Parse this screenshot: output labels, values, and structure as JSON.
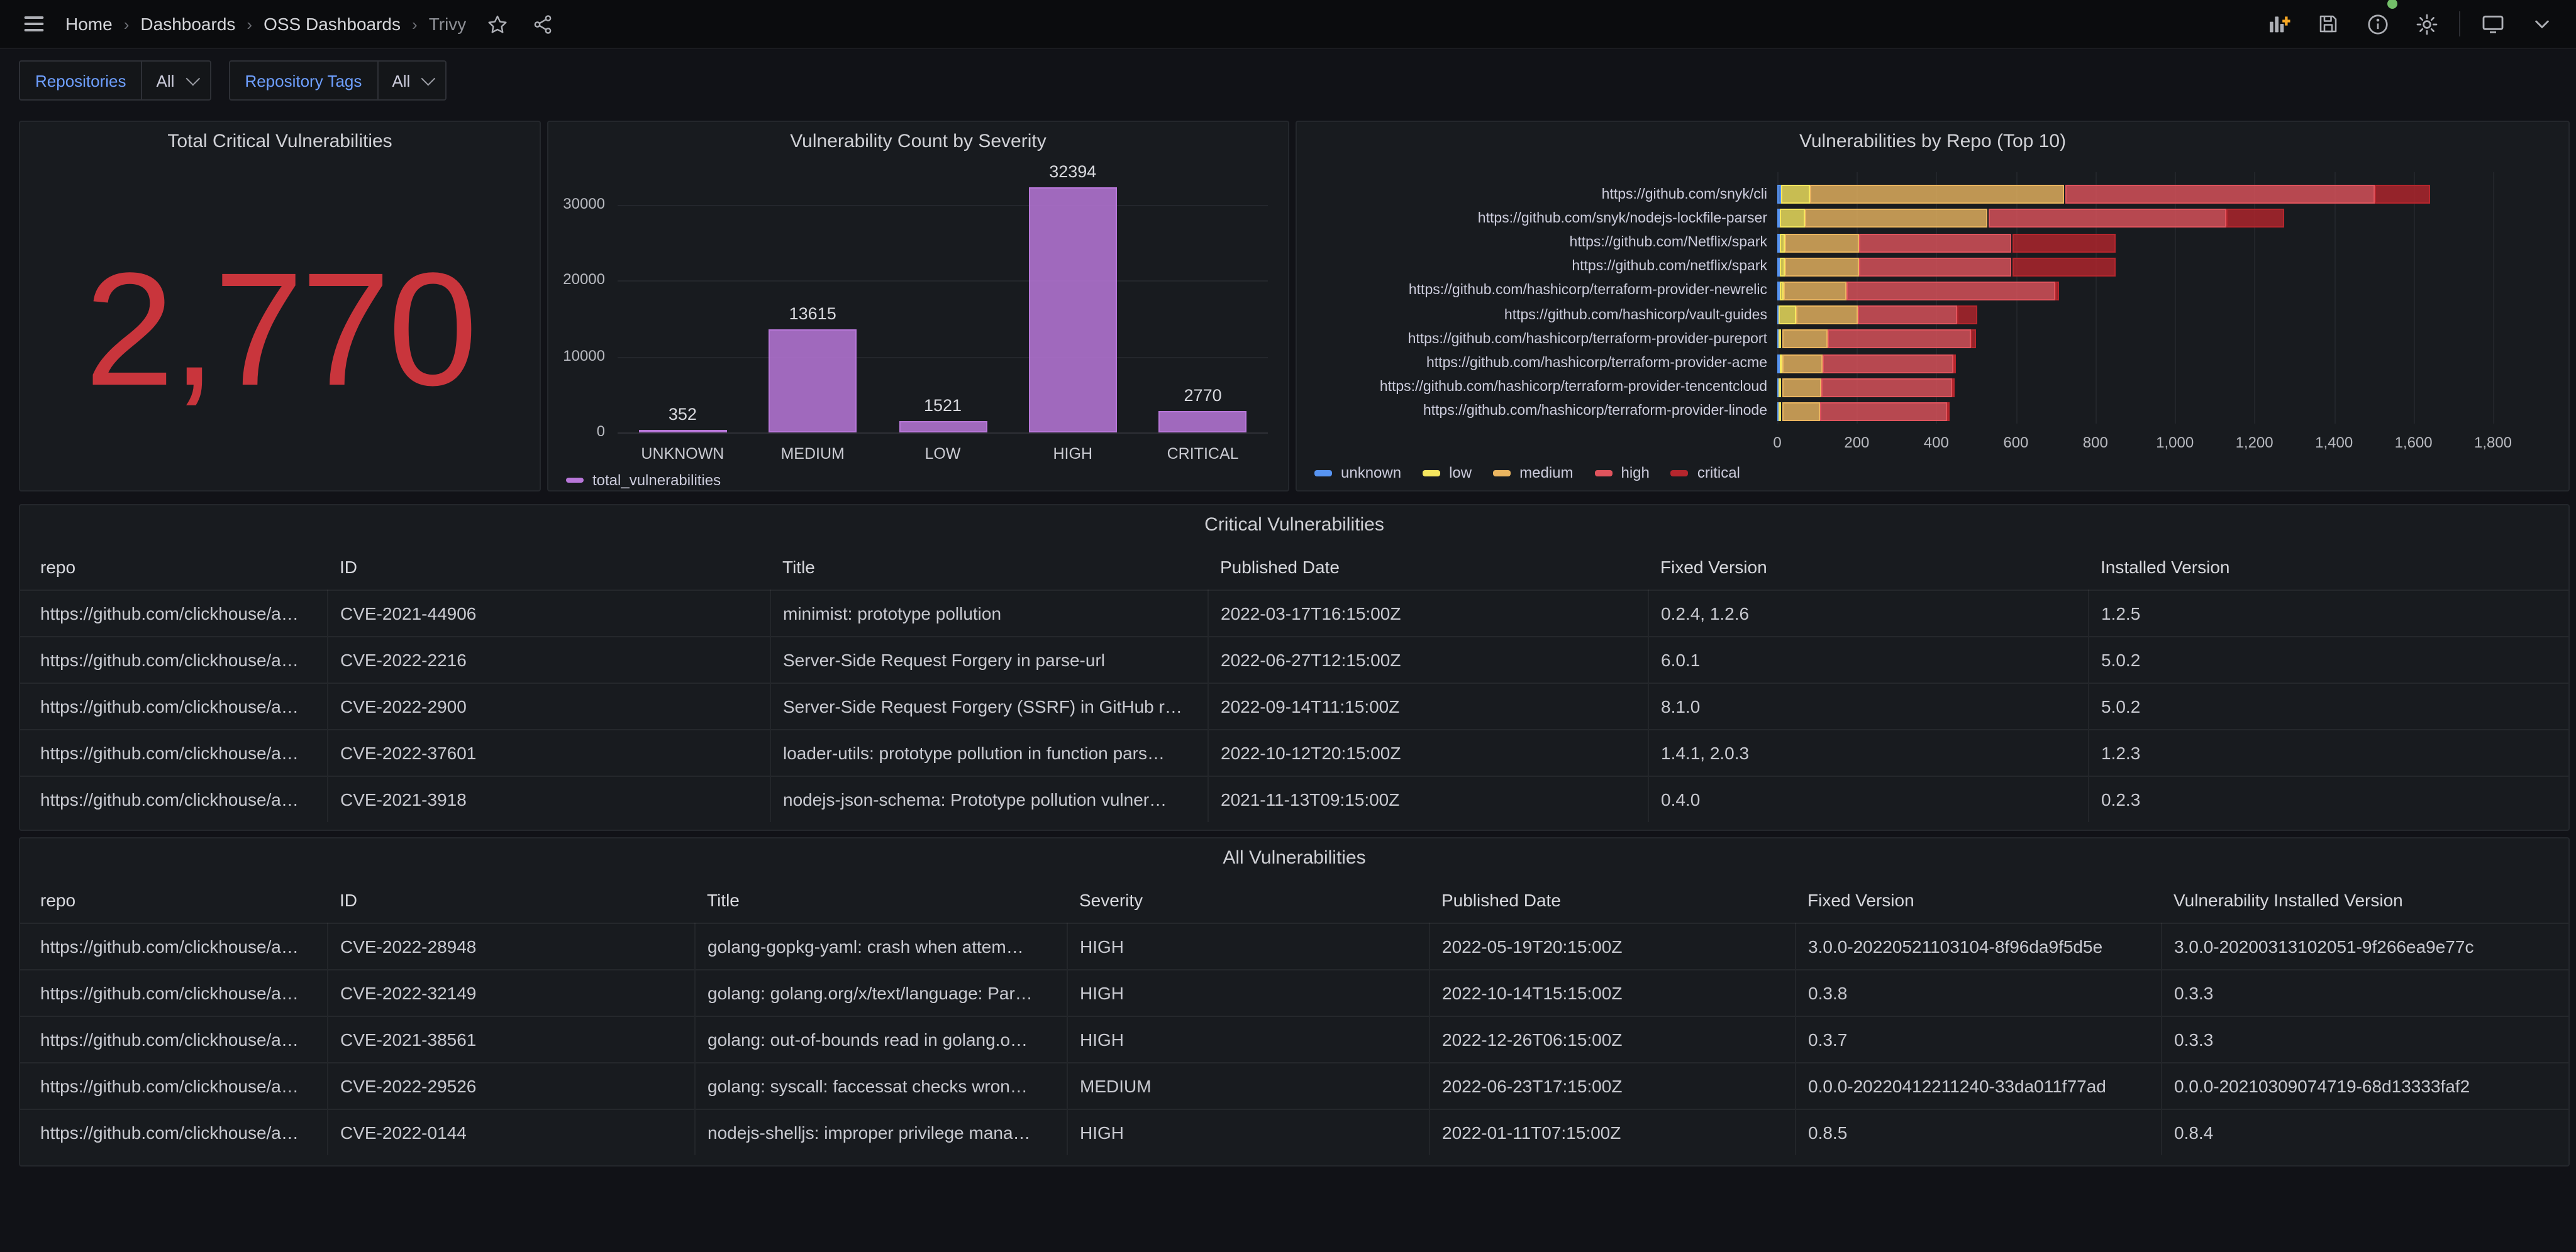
{
  "nav": {
    "breadcrumb": [
      "Home",
      "Dashboards",
      "OSS Dashboards",
      "Trivy"
    ]
  },
  "filters": {
    "groups": [
      {
        "label": "Repositories",
        "value": "All"
      },
      {
        "label": "Repository Tags",
        "value": "All"
      }
    ]
  },
  "panels": {
    "stat": {
      "title": "Total Critical Vulnerabilities",
      "value": "2,770"
    }
  },
  "chart_data": [
    {
      "type": "bar",
      "title": "Vulnerability Count by Severity",
      "categories": [
        "UNKNOWN",
        "MEDIUM",
        "LOW",
        "HIGH",
        "CRITICAL"
      ],
      "values": [
        352,
        13615,
        1521,
        32394,
        2770
      ],
      "series_name": "total_vulnerabilities",
      "bar_color": "#B877D9",
      "y_ticks": [
        0,
        10000,
        20000,
        30000
      ],
      "ylim": [
        0,
        34000
      ],
      "grid": true,
      "legend_position": "bottom-left"
    },
    {
      "type": "bar",
      "orientation": "horizontal",
      "stacked": true,
      "title": "Vulnerabilities by Repo (Top 10)",
      "categories": [
        "https://github.com/snyk/cli",
        "https://github.com/snyk/nodejs-lockfile-parser",
        "https://github.com/Netflix/spark",
        "https://github.com/netflix/spark",
        "https://github.com/hashicorp/terraform-provider-newrelic",
        "https://github.com/hashicorp/vault-guides",
        "https://github.com/hashicorp/terraform-provider-pureport",
        "https://github.com/hashicorp/terraform-provider-acme",
        "https://github.com/hashicorp/terraform-provider-tencentcloud",
        "https://github.com/hashicorp/terraform-provider-linode"
      ],
      "series": [
        {
          "name": "unknown",
          "color": "#5794F2",
          "values": [
            8,
            5,
            5,
            5,
            5,
            3,
            3,
            5,
            3,
            3
          ]
        },
        {
          "name": "low",
          "color": "#F5E65F",
          "values": [
            75,
            65,
            15,
            15,
            10,
            45,
            8,
            8,
            8,
            8
          ]
        },
        {
          "name": "medium",
          "color": "#EAB560",
          "values": [
            640,
            460,
            185,
            185,
            160,
            155,
            115,
            100,
            100,
            95
          ]
        },
        {
          "name": "high",
          "color": "#E0545D",
          "values": [
            780,
            600,
            385,
            385,
            525,
            250,
            360,
            330,
            330,
            320
          ]
        },
        {
          "name": "critical",
          "color": "#B5262D",
          "values": [
            140,
            145,
            260,
            260,
            10,
            50,
            15,
            5,
            5,
            5
          ]
        }
      ],
      "xlim": [
        0,
        1800
      ],
      "x_ticks": [
        0,
        200,
        400,
        600,
        800,
        1000,
        1200,
        1400,
        1600,
        1800
      ],
      "x_tick_labels": [
        "0",
        "200",
        "400",
        "600",
        "800",
        "1,000",
        "1,200",
        "1,400",
        "1,600",
        "1,800"
      ],
      "legend_position": "bottom-left"
    }
  ],
  "tables": {
    "critical": {
      "title": "Critical Vulnerabilities",
      "columns": [
        "repo",
        "ID",
        "Title",
        "Published Date",
        "Fixed Version",
        "Installed Version"
      ],
      "rows": [
        [
          "https://github.com/clickhouse/a…",
          "CVE-2021-44906",
          "minimist: prototype pollution",
          "2022-03-17T16:15:00Z",
          "0.2.4, 1.2.6",
          "1.2.5"
        ],
        [
          "https://github.com/clickhouse/a…",
          "CVE-2022-2216",
          "Server-Side Request Forgery in parse-url",
          "2022-06-27T12:15:00Z",
          "6.0.1",
          "5.0.2"
        ],
        [
          "https://github.com/clickhouse/a…",
          "CVE-2022-2900",
          "Server-Side Request Forgery (SSRF) in GitHub r…",
          "2022-09-14T11:15:00Z",
          "8.1.0",
          "5.0.2"
        ],
        [
          "https://github.com/clickhouse/a…",
          "CVE-2022-37601",
          "loader-utils: prototype pollution in function pars…",
          "2022-10-12T20:15:00Z",
          "1.4.1, 2.0.3",
          "1.2.3"
        ],
        [
          "https://github.com/clickhouse/a…",
          "CVE-2021-3918",
          "nodejs-json-schema: Prototype pollution vulner…",
          "2021-11-13T09:15:00Z",
          "0.4.0",
          "0.2.3"
        ]
      ]
    },
    "all": {
      "title": "All Vulnerabilities",
      "columns": [
        "repo",
        "ID",
        "Title",
        "Severity",
        "Published Date",
        "Fixed Version",
        "Vulnerability Installed Version"
      ],
      "rows": [
        [
          "https://github.com/clickhouse/a…",
          "CVE-2022-28948",
          "golang-gopkg-yaml: crash when attem…",
          "HIGH",
          "2022-05-19T20:15:00Z",
          "3.0.0-20220521103104-8f96da9f5d5e",
          "3.0.0-20200313102051-9f266ea9e77c"
        ],
        [
          "https://github.com/clickhouse/a…",
          "CVE-2022-32149",
          "golang: golang.org/x/text/language: Par…",
          "HIGH",
          "2022-10-14T15:15:00Z",
          "0.3.8",
          "0.3.3"
        ],
        [
          "https://github.com/clickhouse/a…",
          "CVE-2021-38561",
          "golang: out-of-bounds read in golang.o…",
          "HIGH",
          "2022-12-26T06:15:00Z",
          "0.3.7",
          "0.3.3"
        ],
        [
          "https://github.com/clickhouse/a…",
          "CVE-2022-29526",
          "golang: syscall: faccessat checks wron…",
          "MEDIUM",
          "2022-06-23T17:15:00Z",
          "0.0.0-20220412211240-33da011f77ad",
          "0.0.0-20210309074719-68d13333faf2"
        ],
        [
          "https://github.com/clickhouse/a…",
          "CVE-2022-0144",
          "nodejs-shelljs: improper privilege mana…",
          "HIGH",
          "2022-01-11T07:15:00Z",
          "0.8.5",
          "0.8.4"
        ]
      ]
    }
  },
  "colors": {
    "stat_red": "#C9353C",
    "purple": "#B877D9",
    "green_dot": "#73BF69",
    "variable_label_blue": "#6E9FFF",
    "add_panel_plus_orange": "#F5A623"
  }
}
